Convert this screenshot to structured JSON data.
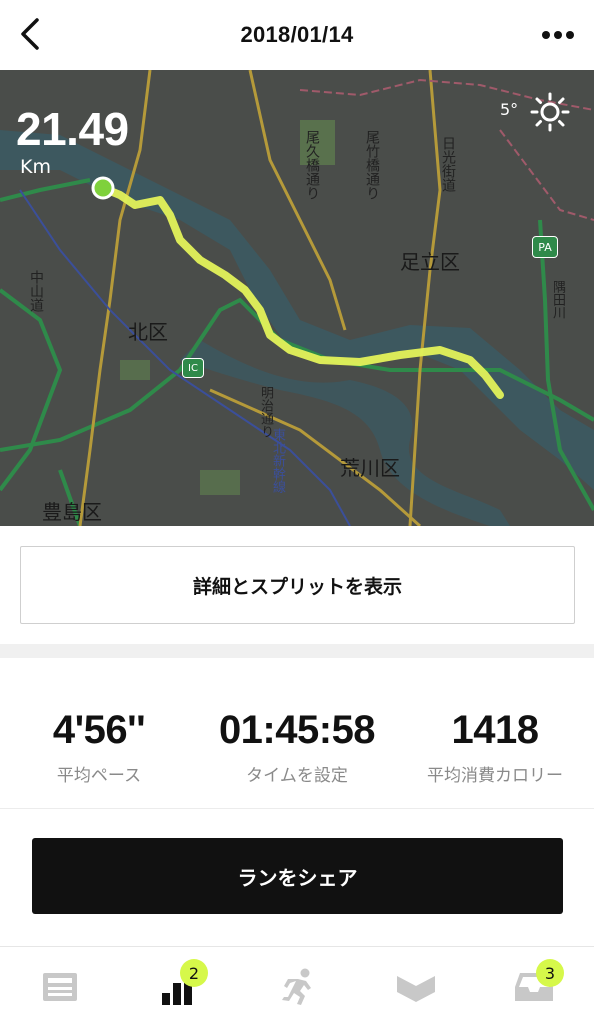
{
  "header": {
    "title": "2018/01/14",
    "back_icon": "chevron-left-icon",
    "more_icon": "more-dots-icon"
  },
  "map": {
    "distance_value": "21.49",
    "distance_unit": "Km",
    "temperature": "5°",
    "weather_icon": "sun-icon",
    "labels": {
      "adachi": "足立区",
      "kita": "北区",
      "arakawa": "荒川区",
      "toshima": "豊島区",
      "nakasendo": "中山道",
      "nikko": "日光街道",
      "meiji": "明治通り",
      "ogu": "尾久橋通り",
      "otake": "尾竹橋通り",
      "jr": "東北新幹線",
      "pa": "PA",
      "ic": "IC",
      "sumida": "隅田川"
    },
    "route_color": "#e3f25a",
    "start_color": "#7fd13c"
  },
  "detail_button": "詳細とスプリットを表示",
  "stats": [
    {
      "value": "4'56''",
      "label": "平均ペース"
    },
    {
      "value": "01:45:58",
      "label": "タイムを設定"
    },
    {
      "value": "1418",
      "label": "平均消費カロリー"
    }
  ],
  "share_button": "ランをシェア",
  "tabbar": {
    "tabs": [
      {
        "name": "feed",
        "icon": "feed-icon"
      },
      {
        "name": "activity",
        "icon": "bar-chart-icon",
        "badge": "2",
        "active": true
      },
      {
        "name": "run",
        "icon": "runner-icon"
      },
      {
        "name": "club",
        "icon": "chevron-badge-icon"
      },
      {
        "name": "inbox",
        "icon": "inbox-icon",
        "badge": "3"
      }
    ]
  },
  "colors": {
    "accent_badge": "#d6f84a",
    "map_bg": "#4a4d4a"
  }
}
